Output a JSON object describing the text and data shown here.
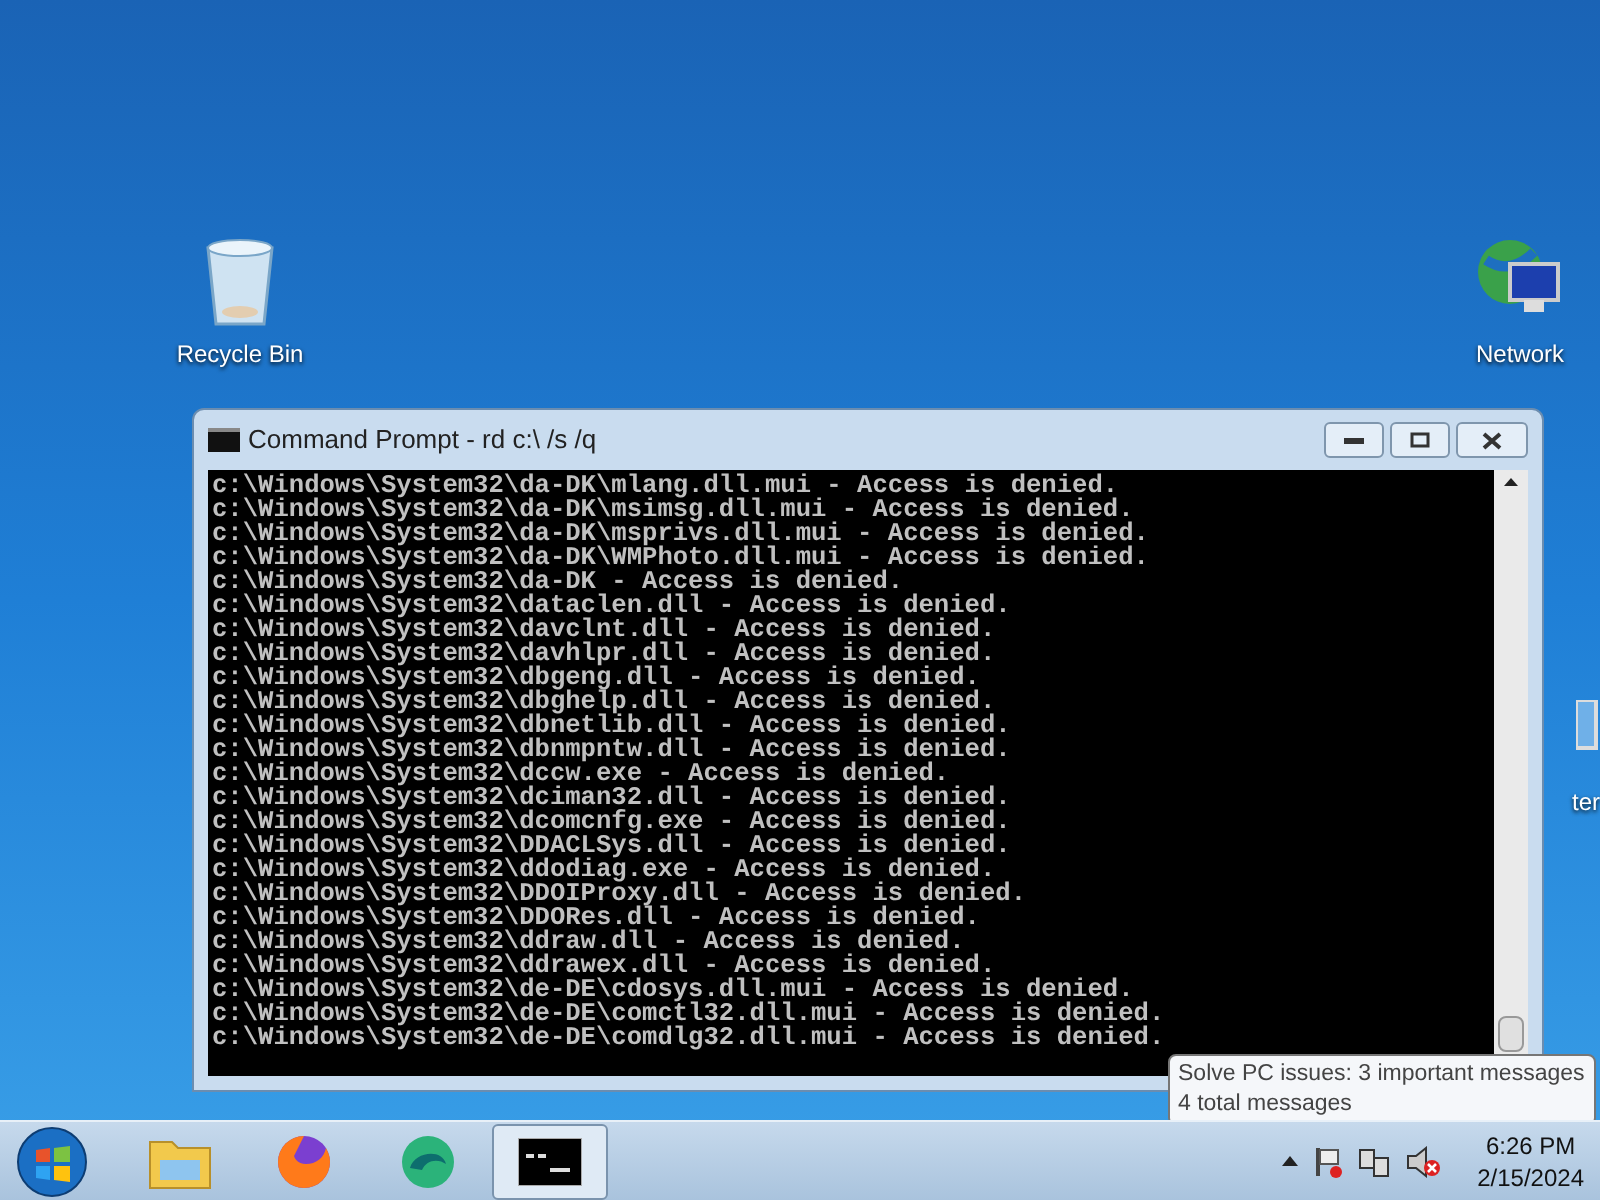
{
  "desktop_icons": [
    {
      "kind": "recycle",
      "label": "Recycle Bin"
    },
    {
      "kind": "network",
      "label": "Network"
    },
    {
      "kind": "computer",
      "label": "ter"
    }
  ],
  "window": {
    "title": "Command Prompt - rd  c:\\ /s /q",
    "lines": [
      "c:\\Windows\\System32\\da-DK\\mlang.dll.mui - Access is denied.",
      "c:\\Windows\\System32\\da-DK\\msimsg.dll.mui - Access is denied.",
      "c:\\Windows\\System32\\da-DK\\msprivs.dll.mui - Access is denied.",
      "c:\\Windows\\System32\\da-DK\\WMPhoto.dll.mui - Access is denied.",
      "c:\\Windows\\System32\\da-DK - Access is denied.",
      "c:\\Windows\\System32\\dataclen.dll - Access is denied.",
      "c:\\Windows\\System32\\davclnt.dll - Access is denied.",
      "c:\\Windows\\System32\\davhlpr.dll - Access is denied.",
      "c:\\Windows\\System32\\dbgeng.dll - Access is denied.",
      "c:\\Windows\\System32\\dbghelp.dll - Access is denied.",
      "c:\\Windows\\System32\\dbnetlib.dll - Access is denied.",
      "c:\\Windows\\System32\\dbnmpntw.dll - Access is denied.",
      "c:\\Windows\\System32\\dccw.exe - Access is denied.",
      "c:\\Windows\\System32\\dciman32.dll - Access is denied.",
      "c:\\Windows\\System32\\dcomcnfg.exe - Access is denied.",
      "c:\\Windows\\System32\\DDACLSys.dll - Access is denied.",
      "c:\\Windows\\System32\\ddodiag.exe - Access is denied.",
      "c:\\Windows\\System32\\DDOIProxy.dll - Access is denied.",
      "c:\\Windows\\System32\\DDORes.dll - Access is denied.",
      "c:\\Windows\\System32\\ddraw.dll - Access is denied.",
      "c:\\Windows\\System32\\ddrawex.dll - Access is denied.",
      "c:\\Windows\\System32\\de-DE\\cdosys.dll.mui - Access is denied.",
      "c:\\Windows\\System32\\de-DE\\comctl32.dll.mui - Access is denied.",
      "c:\\Windows\\System32\\de-DE\\comdlg32.dll.mui - Access is denied."
    ]
  },
  "tooltip": {
    "title": "Solve PC issues: 3 important messages",
    "body": "4 total messages"
  },
  "taskbar": {
    "apps": [
      {
        "kind": "explorer",
        "active": false
      },
      {
        "kind": "firefox",
        "active": false
      },
      {
        "kind": "edge",
        "active": false
      },
      {
        "kind": "cmd",
        "active": true
      }
    ],
    "clock": {
      "time": "6:26 PM",
      "date": "2/15/2024"
    }
  }
}
